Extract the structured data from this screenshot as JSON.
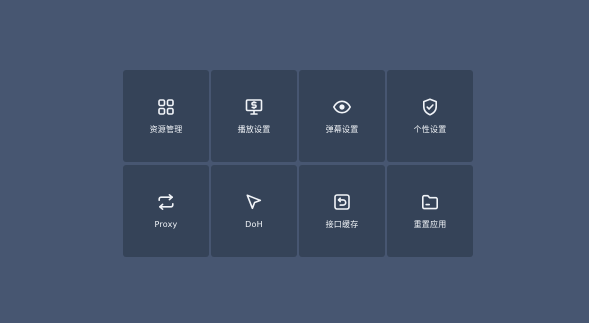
{
  "menu": {
    "items": [
      {
        "label": "资源管理",
        "icon": "grid-icon"
      },
      {
        "label": "播放设置",
        "icon": "monitor-dollar-icon"
      },
      {
        "label": "弹幕设置",
        "icon": "eye-icon"
      },
      {
        "label": "个性设置",
        "icon": "shield-check-icon"
      },
      {
        "label": "Proxy",
        "icon": "swap-arrows-icon"
      },
      {
        "label": "DoH",
        "icon": "cursor-arrow-icon"
      },
      {
        "label": "接口缓存",
        "icon": "cache-restore-icon"
      },
      {
        "label": "重置应用",
        "icon": "folder-icon"
      }
    ]
  },
  "colors": {
    "background": "#475671",
    "tile": "#354358",
    "text": "#f1f4f8"
  }
}
